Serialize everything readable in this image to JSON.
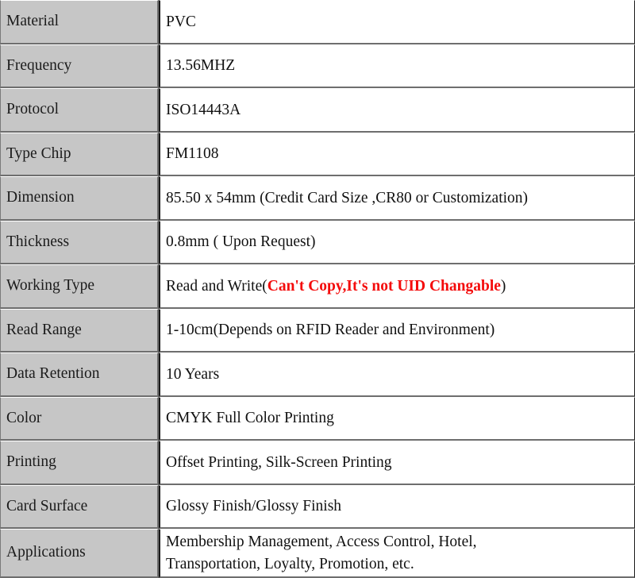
{
  "table": {
    "accent_warning_color": "#f40b0b",
    "label_column_bg": "#c6c6c6",
    "value_column_bg": "#ffffff",
    "rows": [
      {
        "label": "Material",
        "value": "PVC"
      },
      {
        "label": "Frequency",
        "value": "13.56MHZ"
      },
      {
        "label": "Protocol",
        "value": "ISO14443A"
      },
      {
        "label": "Type Chip",
        "value": "FM1108"
      },
      {
        "label": "Dimension",
        "value": "85.50 x 54mm (Credit Card Size ,CR80 or Customization)"
      },
      {
        "label": "Thickness",
        "value": "0.8mm ( Upon Request)"
      },
      {
        "label": "Working Type",
        "value_prefix": "Read and Write(",
        "value_warning": "Can't Copy,It's not UID Changable",
        "value_suffix": ")"
      },
      {
        "label": "Read Range",
        "value": "1-10cm(Depends on RFID Reader and Environment)"
      },
      {
        "label": "Data Retention",
        "value": "10 Years"
      },
      {
        "label": "Color",
        "value": "CMYK Full Color Printing"
      },
      {
        "label": "Printing",
        "value": "Offset Printing, Silk-Screen Printing"
      },
      {
        "label": "Card Surface",
        "value": "Glossy Finish/Glossy Finish"
      },
      {
        "label": "Applications",
        "value_line1": "Membership Management, Access Control, Hotel,",
        "value_line2": "Transportation, Loyalty, Promotion, etc."
      }
    ]
  }
}
